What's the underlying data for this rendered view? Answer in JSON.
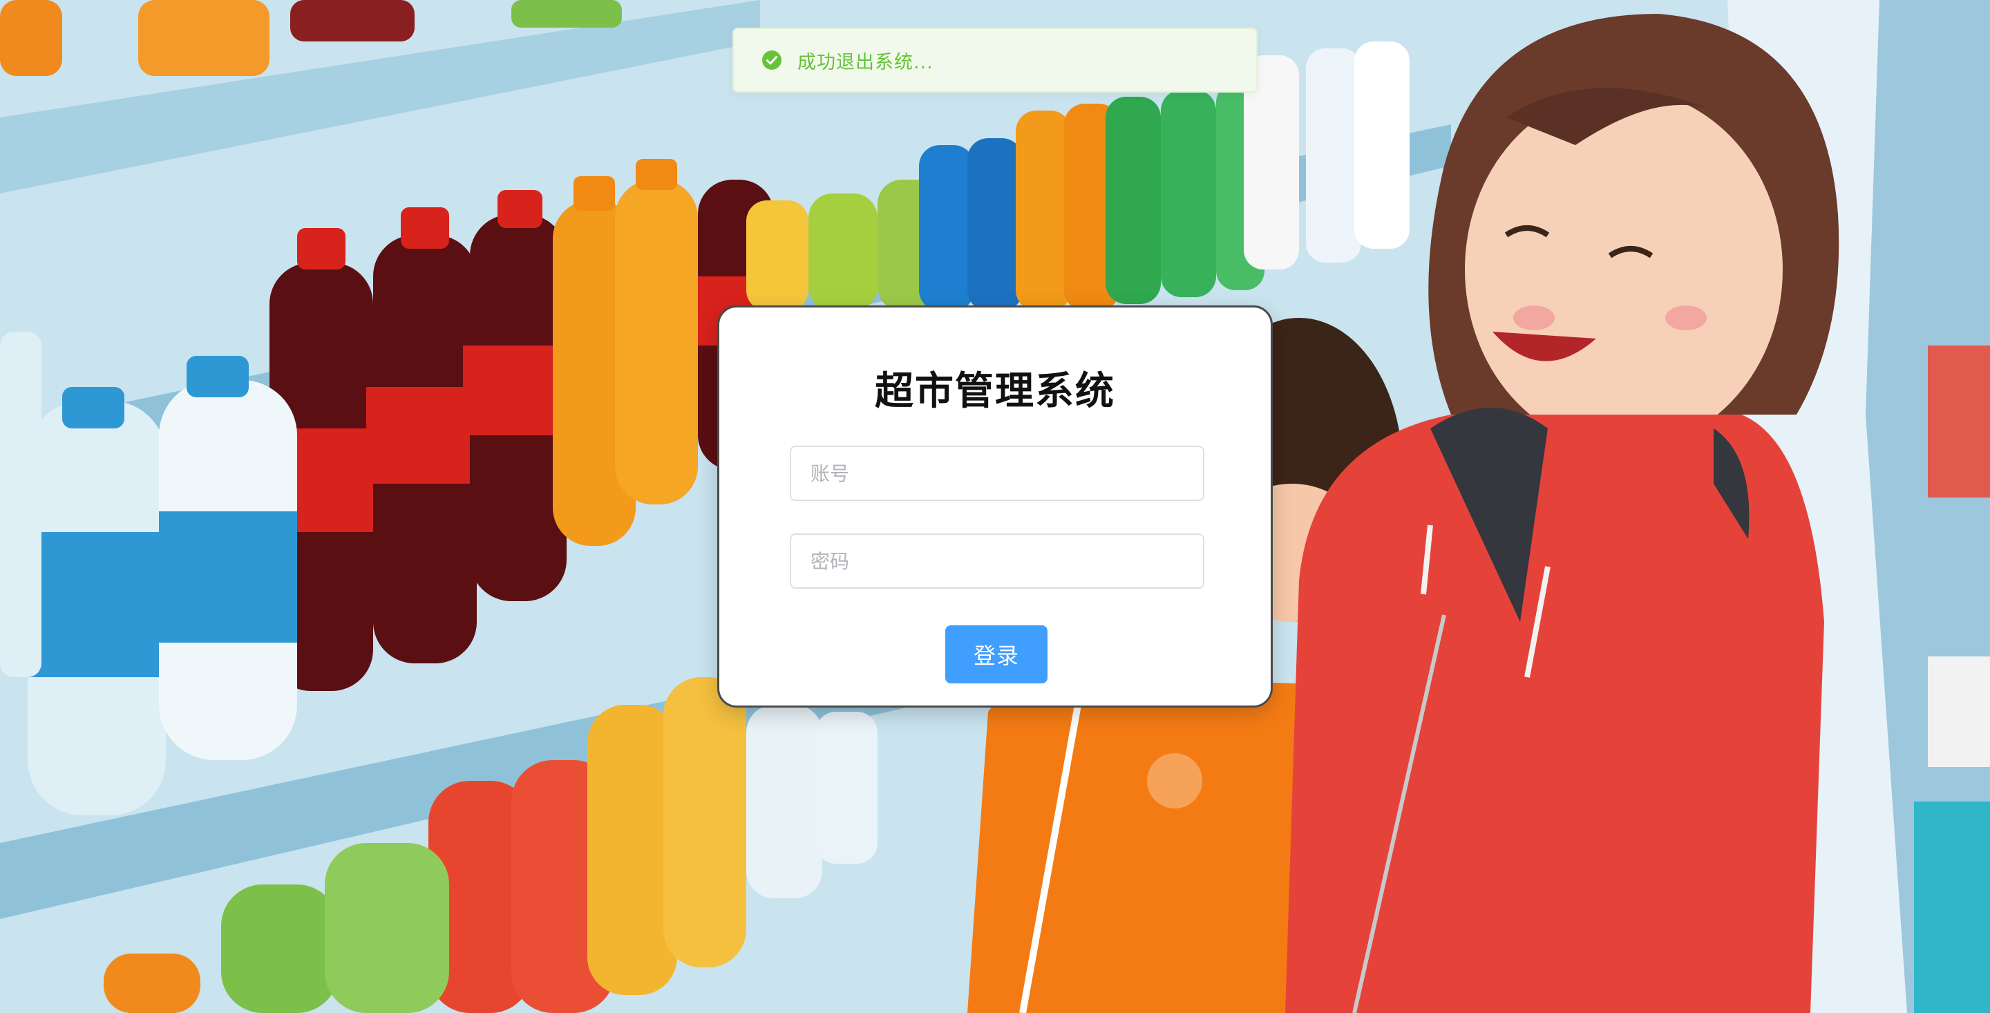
{
  "toast": {
    "message": "成功退出系统...",
    "icon": "check-circle-icon",
    "color": "#67c23a"
  },
  "login": {
    "title": "超市管理系统",
    "account_placeholder": "账号",
    "password_placeholder": "密码",
    "submit_label": "登录",
    "accent": "#409eff"
  }
}
